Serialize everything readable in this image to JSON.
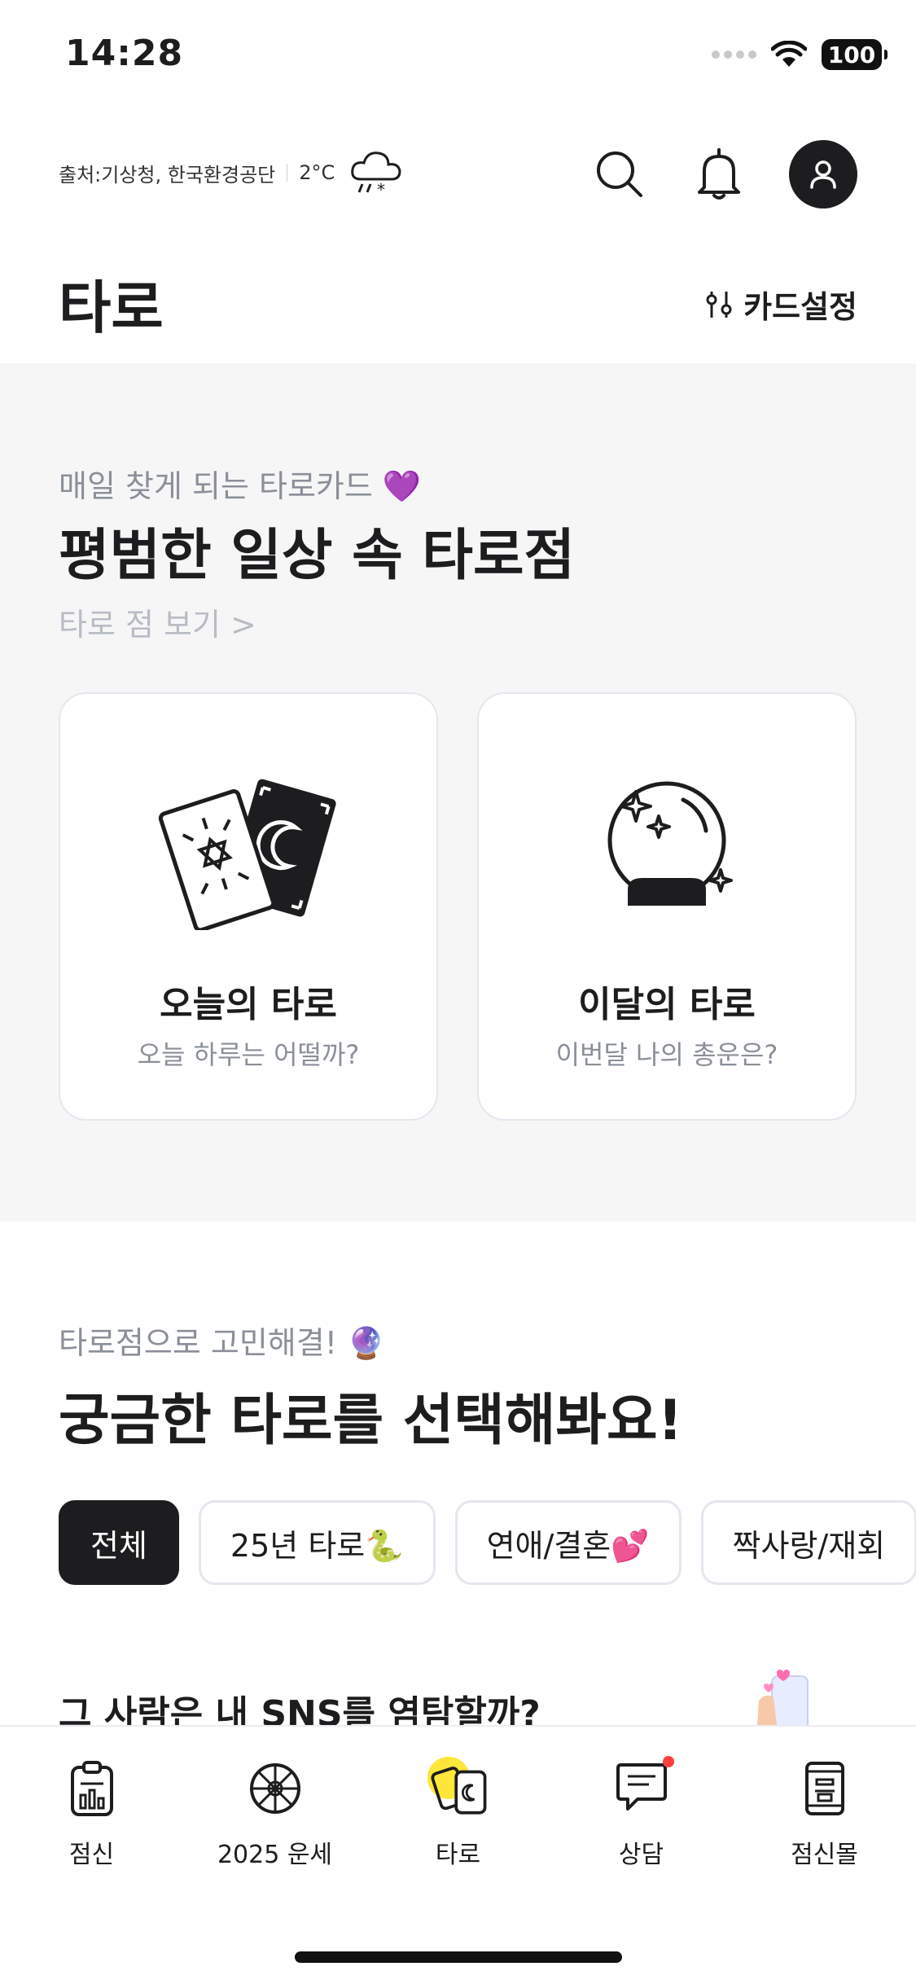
{
  "status_bar": {
    "time": "14:28",
    "battery": "100"
  },
  "weather": {
    "source": "출처:기상청, 한국환경공단",
    "temperature": "2°C",
    "icon": "snow-rain-cloud-icon"
  },
  "header": {
    "title": "타로",
    "card_setting": "카드설정"
  },
  "hero": {
    "subtitle": "매일 찾게 되는 타로카드 💜",
    "title": "평범한 일상 속 타로점",
    "link": "타로 점 보기 >",
    "cards": [
      {
        "title": "오늘의 타로",
        "subtitle": "오늘 하루는 어떨까?",
        "icon": "tarot-cards-icon"
      },
      {
        "title": "이달의 타로",
        "subtitle": "이번달 나의 총운은?",
        "icon": "crystal-ball-icon"
      }
    ]
  },
  "section2": {
    "subtitle": "타로점으로 고민해결! 🔮",
    "title": "궁금한 타로를 선택해봐요!",
    "chips": [
      "전체",
      "25년 타로🐍",
      "연애/결혼💕",
      "짝사랑/재회"
    ],
    "selected_chip": "전체",
    "peek_item_title": "그 사람은 내 SNS를 염탐할까?"
  },
  "tabbar": {
    "items": [
      {
        "label": "점신",
        "icon": "clipboard-chart-icon"
      },
      {
        "label": "2025 운세",
        "icon": "fortune-wheel-icon"
      },
      {
        "label": "타로",
        "icon": "tarot-tab-icon"
      },
      {
        "label": "상담",
        "icon": "chat-bubble-icon"
      },
      {
        "label": "점신몰",
        "icon": "shop-scroll-icon"
      }
    ],
    "active": "타로"
  },
  "colors": {
    "text": "#1d1d1f",
    "muted": "#8a8f98",
    "hero_bg": "#f6f6f7",
    "border": "#e4e7ee",
    "active_highlight": "#ffe63b",
    "badge": "#ff4040"
  }
}
